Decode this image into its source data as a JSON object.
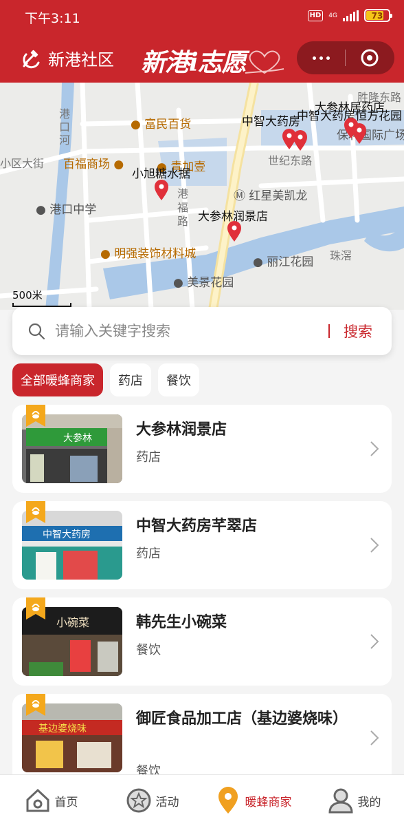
{
  "status_bar": {
    "time": "下午3:11",
    "hd": "HD",
    "network": "4G",
    "battery": "73"
  },
  "header": {
    "community": "新港社区",
    "brand": "新港i志愿"
  },
  "map": {
    "roads": [
      "胜隆东路",
      "世纪东路",
      "港口河",
      "小区大街",
      "港福路",
      "珠滘"
    ],
    "pois": [
      "富民百货",
      "百福商场",
      "青加壹",
      "港口中学",
      "红星美凯龙",
      "明强装饰材料城",
      "丽江花园",
      "美景花园",
      "保利国际广场"
    ],
    "shops": [
      "中智大药房",
      "大参林居药店",
      "中智大药房恒方花园",
      "小旭糖水据",
      "大参林润景店"
    ],
    "scale": "500米"
  },
  "search": {
    "placeholder": "请输入关键字搜索",
    "button": "搜索"
  },
  "filters": [
    "全部暖蜂商家",
    "药店",
    "餐饮"
  ],
  "shops": [
    {
      "name": "大参林润景店",
      "category": "药店",
      "sign": "大参林"
    },
    {
      "name": "中智大药房芊翠店",
      "category": "药店",
      "sign": "中智大药房"
    },
    {
      "name": "韩先生小碗菜",
      "category": "餐饮",
      "sign": "小碗菜"
    },
    {
      "name": "御匠食品加工店（基边婆烧味）",
      "category": "餐饮",
      "sign": "基边婆烧味"
    }
  ],
  "tabs": [
    "首页",
    "活动",
    "暖蜂商家",
    "我的"
  ],
  "colors": {
    "primary": "#c9262c",
    "map_water": "#aac8e8",
    "poi_orange": "#f0a020"
  }
}
